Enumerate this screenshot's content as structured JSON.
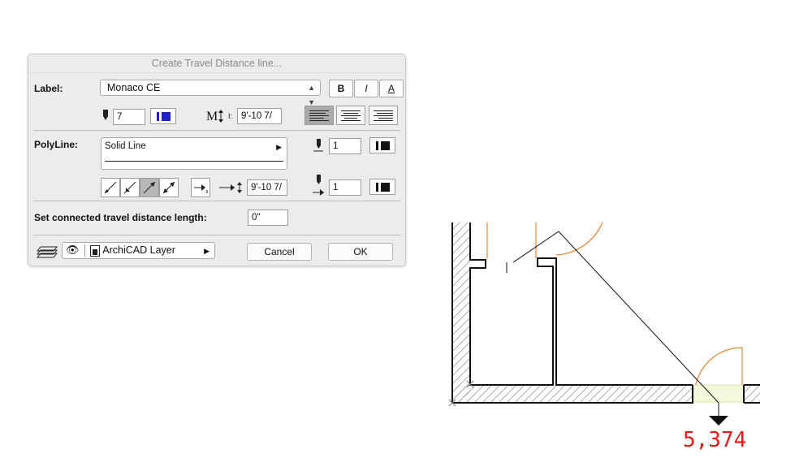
{
  "dialog": {
    "title": "Create Travel Distance line...",
    "label_section": {
      "label": "Label:",
      "font_value": "Monaco CE",
      "style_buttons": [
        "B",
        "I",
        "A"
      ],
      "pen_value": "7",
      "text_size_value": "9'-10 7/",
      "text_size_unit": "I:"
    },
    "polyline_section": {
      "label": "PolyLine:",
      "line_type_value": "Solid Line",
      "pen_value_top": "1",
      "arrow_size_value": "9'-10 7/",
      "pen_value_bottom": "1"
    },
    "travel": {
      "label": "Set connected travel distance length:",
      "value": "0\""
    },
    "layer": {
      "value": "ArchiCAD Layer"
    },
    "buttons": {
      "cancel": "Cancel",
      "ok": "OK"
    }
  },
  "drawing": {
    "distance_value": "5,374",
    "colors": {
      "door_arc": "#e8812e",
      "distance_text": "#e41b17",
      "floor_fill": "#f6f8dc"
    }
  }
}
